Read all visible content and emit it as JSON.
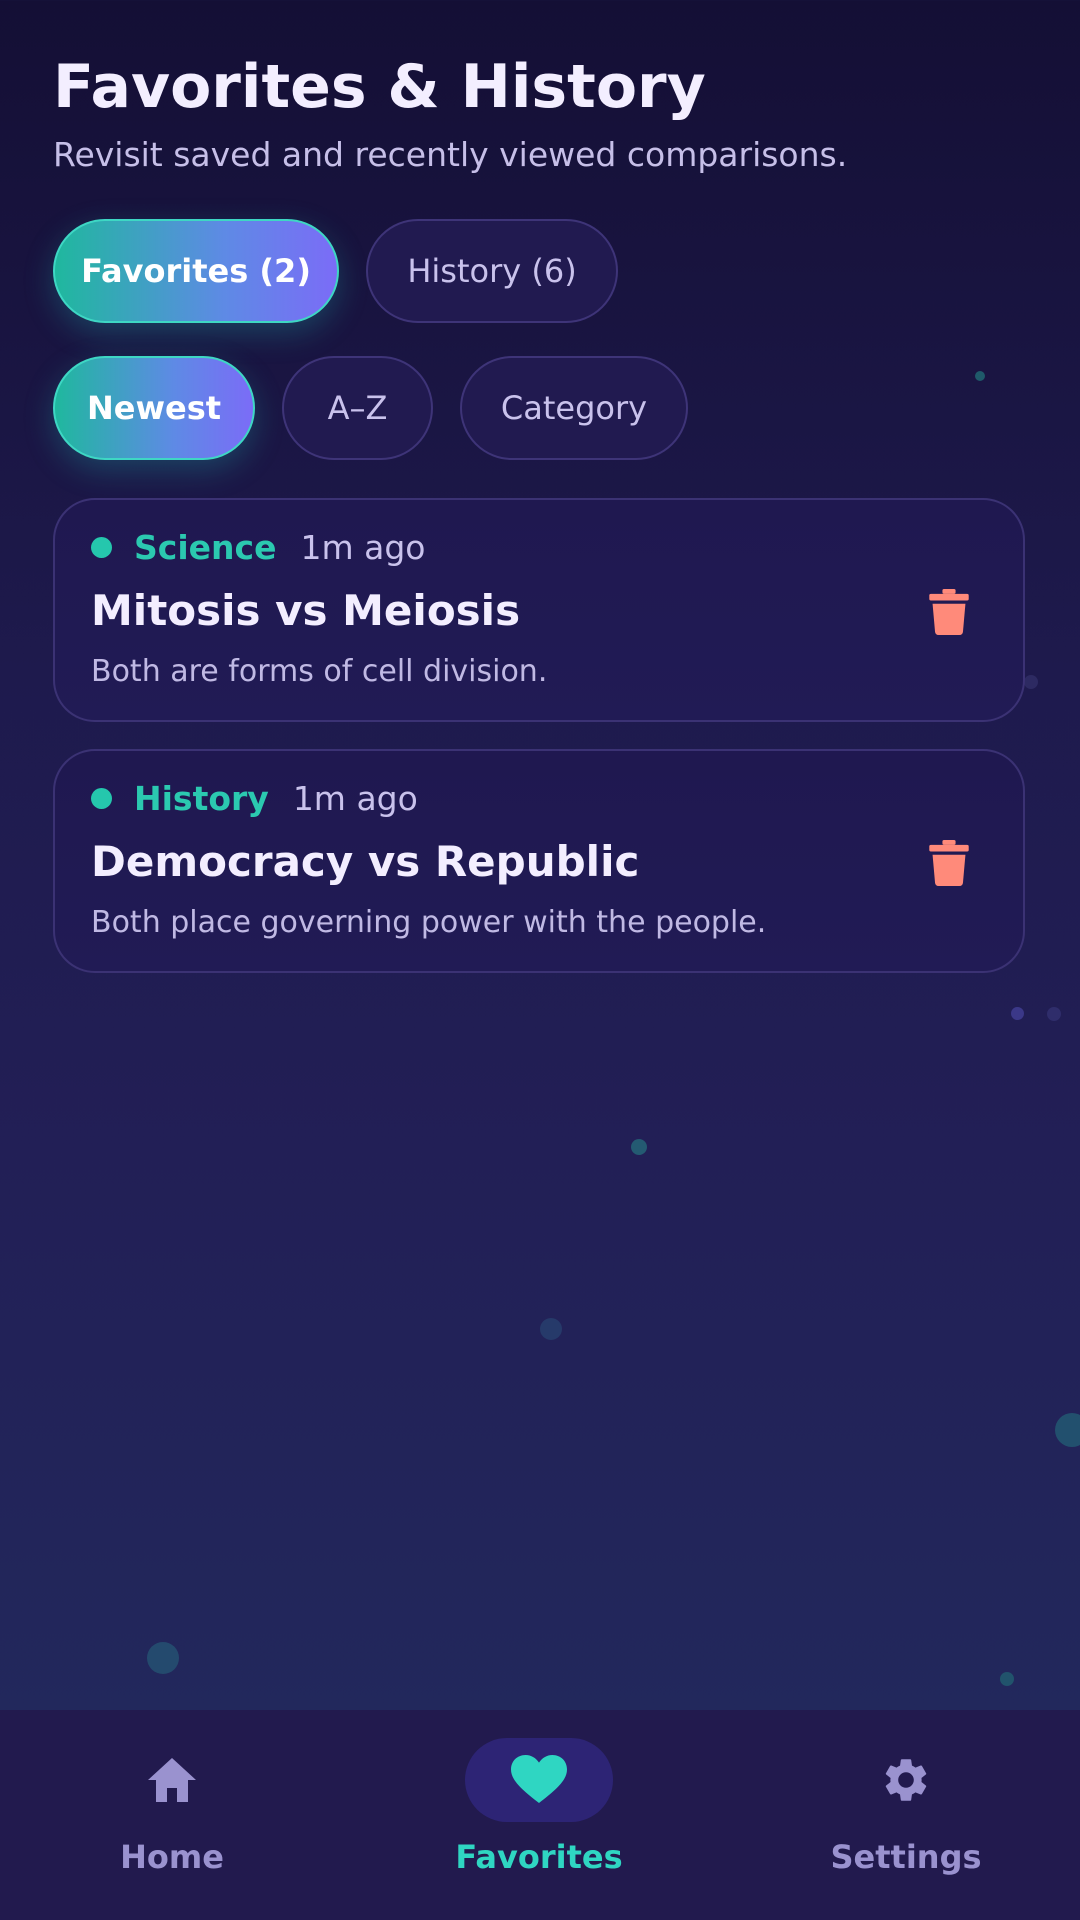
{
  "header": {
    "title": "Favorites & History",
    "subtitle": "Revisit saved and recently viewed comparisons."
  },
  "tabs": [
    {
      "label": "Favorites (2)",
      "active": true
    },
    {
      "label": "History (6)",
      "active": false
    }
  ],
  "sort_options": [
    {
      "label": "Newest",
      "active": true
    },
    {
      "label": "A–Z",
      "active": false
    },
    {
      "label": "Category",
      "active": false
    }
  ],
  "items": [
    {
      "category": "Science",
      "time": "1m ago",
      "title": "Mitosis vs Meiosis",
      "description": "Both are forms of cell division.",
      "delete_icon": "trash-icon"
    },
    {
      "category": "History",
      "time": "1m ago",
      "title": "Democracy vs Republic",
      "description": "Both place governing power with the people.",
      "delete_icon": "trash-icon"
    }
  ],
  "bottom_nav": [
    {
      "label": "Home",
      "icon": "home-icon",
      "active": false
    },
    {
      "label": "Favorites",
      "icon": "heart-icon",
      "active": true
    },
    {
      "label": "Settings",
      "icon": "gear-icon",
      "active": false
    }
  ],
  "colors": {
    "accent_teal": "#2fd6c2",
    "accent_purple": "#7b6cf7",
    "delete_red": "#ff8a7a",
    "background": "#1e1a4d"
  }
}
